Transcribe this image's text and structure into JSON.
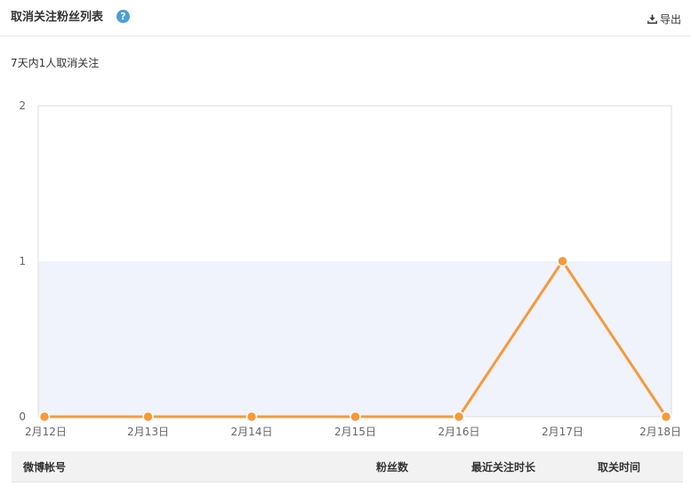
{
  "header": {
    "title": "取消关注粉丝列表",
    "help_icon": "question-icon",
    "help_glyph": "?",
    "export_label": "导出",
    "export_icon": "download-icon"
  },
  "summary_text": "7天内1人取消关注",
  "colors": {
    "accent": "#f7993a",
    "help": "#4a9fd8",
    "band": "#f0f3fc",
    "grid": "#dddddd"
  },
  "chart_data": {
    "type": "line",
    "categories": [
      "2月12日",
      "2月13日",
      "2月14日",
      "2月15日",
      "2月16日",
      "2月17日",
      "2月18日"
    ],
    "series": [
      {
        "values": [
          0,
          0,
          0,
          0,
          0,
          1,
          0
        ]
      }
    ],
    "ylim": [
      0,
      2
    ],
    "yticks": [
      0,
      1,
      2
    ],
    "grid": false
  },
  "table": {
    "columns": [
      "微博帐号",
      "粉丝数",
      "最近关注时长",
      "取关时间"
    ]
  }
}
